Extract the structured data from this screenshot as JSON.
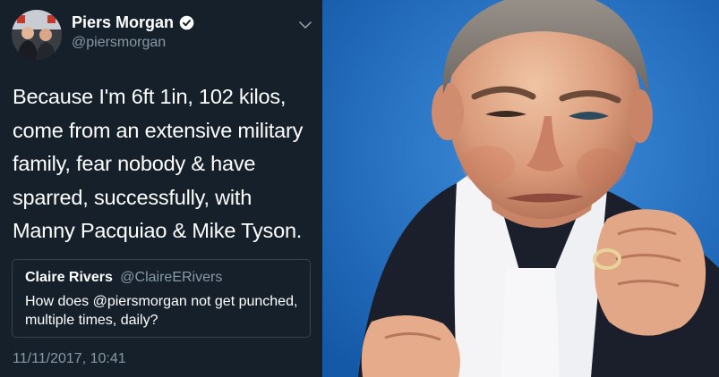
{
  "tweet": {
    "display_name": "Piers Morgan",
    "handle": "@piersmorgan",
    "text": "Because I'm 6ft 1in, 102 kilos, come from an extensive military family, fear nobody & have sparred, successfully, with Manny Pacquiao & Mike Tyson.",
    "timestamp": "11/11/2017, 10:41",
    "icons": {
      "verified": "verified-badge-icon",
      "menu": "chevron-down-icon"
    },
    "colors": {
      "background": "#15202b",
      "secondary_text": "#8899a6",
      "verified": "#ffffff",
      "border": "#38444d"
    }
  },
  "quoted_tweet": {
    "display_name": "Claire Rivers",
    "handle": "@ClaireERivers",
    "text": "How does @piersmorgan not get punched, multiple times, daily?"
  },
  "photo": {
    "background_color": "#1d6fc2"
  }
}
